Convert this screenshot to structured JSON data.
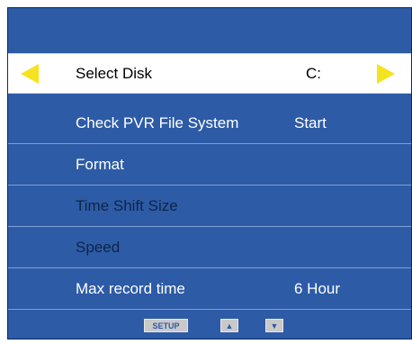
{
  "menu": {
    "items": [
      {
        "label": "Select Disk",
        "value": "C:"
      },
      {
        "label": "Check PVR File System",
        "value": "Start"
      },
      {
        "label": "Format",
        "value": ""
      },
      {
        "label": "Time Shift Size",
        "value": ""
      },
      {
        "label": "Speed",
        "value": ""
      },
      {
        "label": "Max record time",
        "value": "6 Hour"
      }
    ],
    "selected_index": 0
  },
  "footer": {
    "setup_label": "SETUP",
    "up_label": "▲",
    "down_label": "▼"
  },
  "colors": {
    "background": "#2d5ba6",
    "highlight": "#ffffff",
    "arrow": "#f5e31f",
    "disabled_text": "#0f2548"
  },
  "icons": {
    "left_arrow": "triangle-left-icon",
    "right_arrow": "triangle-right-icon",
    "up_arrow": "triangle-up-icon",
    "down_arrow": "triangle-down-icon"
  }
}
